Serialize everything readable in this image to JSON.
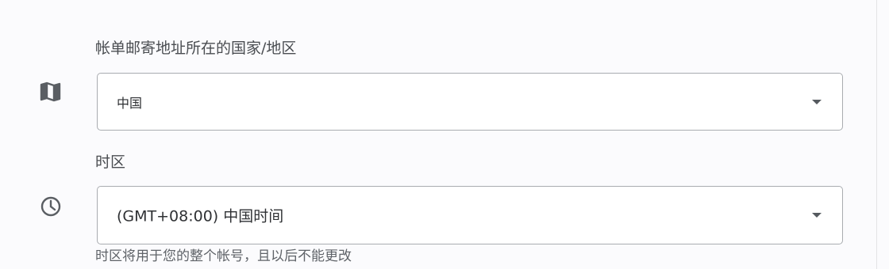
{
  "billing_country": {
    "label": "帐单邮寄地址所在的国家/地区",
    "selected": "中国",
    "icon": "map-icon"
  },
  "timezone": {
    "label": "时区",
    "selected": "(GMT+08:00) 中国时间",
    "icon": "clock-icon",
    "helper": "时区将用于您的整个帐号，且以后不能更改"
  }
}
